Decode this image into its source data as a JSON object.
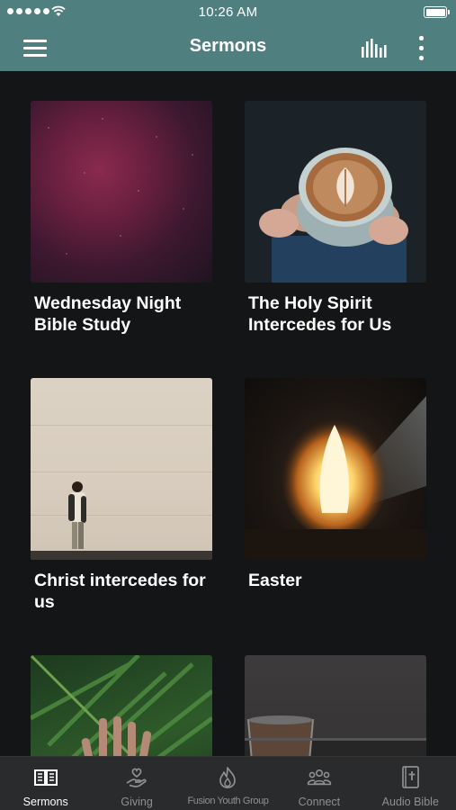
{
  "status_bar": {
    "time": "10:26 AM"
  },
  "app_bar": {
    "title": "Sermons"
  },
  "sermons": [
    {
      "title": "Wednesday Night Bible Study"
    },
    {
      "title": "The Holy Spirit Intercedes for Us"
    },
    {
      "title": "Christ intercedes for us"
    },
    {
      "title": "Easter"
    },
    {
      "title": ""
    },
    {
      "title": ""
    }
  ],
  "tabs": [
    {
      "label": "Sermons",
      "icon": "book-open-icon",
      "active": true
    },
    {
      "label": "Giving",
      "icon": "hand-heart-icon",
      "active": false
    },
    {
      "label": "Fusion Youth Group",
      "icon": "flame-icon",
      "active": false
    },
    {
      "label": "Connect",
      "icon": "people-icon",
      "active": false
    },
    {
      "label": "Audio Bible",
      "icon": "bible-cross-icon",
      "active": false
    }
  ],
  "colors": {
    "header": "#4f7f7f",
    "background": "#141516",
    "tab_bar": "#2a2b2d",
    "tab_inactive": "#8f9091",
    "tab_active": "#ffffff"
  }
}
